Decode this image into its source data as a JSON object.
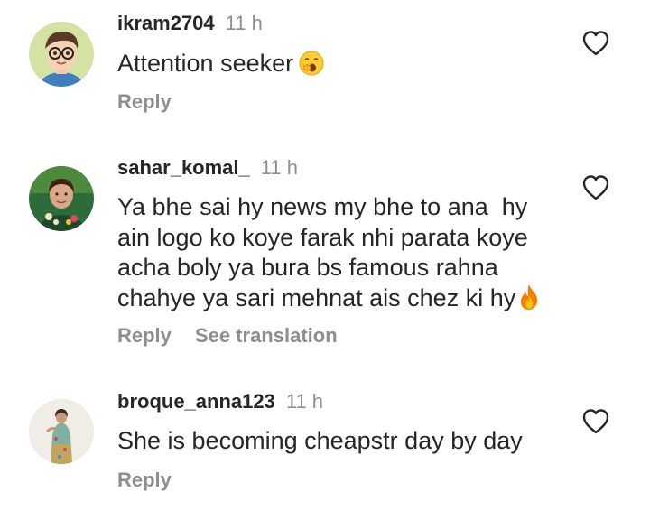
{
  "comments": [
    {
      "username": "ikram2704",
      "time": "11 h",
      "text": "Attention seeker",
      "emoji": "yawning-face-emoji",
      "reply_label": "Reply"
    },
    {
      "username": "sahar_komal_",
      "time": "11 h",
      "lines": [
        "Ya bhe sai hy news my bhe to ana  hy",
        "ain logo ko koye farak nhi parata koye",
        "acha boly ya bura bs famous rahna",
        "chahye ya sari mehnat ais chez ki hy"
      ],
      "emoji": "fire-emoji",
      "reply_label": "Reply",
      "translate_label": "See translation"
    },
    {
      "username": "broque_anna123",
      "time": "11 h",
      "text": "She is becoming cheapstr day by day",
      "reply_label": "Reply"
    }
  ],
  "icons": {
    "like": "heart-outline-icon"
  },
  "colors": {
    "text": "#262626",
    "secondary": "#8e8e8e",
    "background": "#ffffff"
  }
}
